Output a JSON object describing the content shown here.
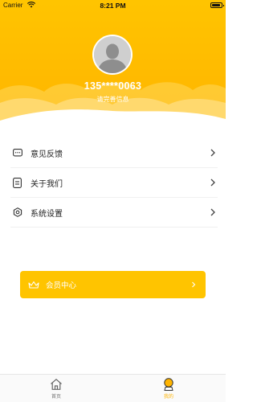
{
  "status_bar": {
    "carrier": "Carrier",
    "time": "8:21 PM"
  },
  "profile": {
    "phone": "135****0063",
    "subtitle": "请完善信息"
  },
  "menu": {
    "items": [
      {
        "label": "意见反馈",
        "icon": "feedback-icon"
      },
      {
        "label": "关于我们",
        "icon": "document-icon"
      },
      {
        "label": "系统设置",
        "icon": "settings-gear-icon"
      }
    ]
  },
  "member": {
    "label": "会员中心",
    "icon": "crown-icon"
  },
  "tabbar": {
    "tabs": [
      {
        "label": "首页",
        "icon": "home-icon",
        "active": false
      },
      {
        "label": "我的",
        "icon": "profile-icon",
        "active": true
      }
    ]
  },
  "colors": {
    "accent": "#FFC400",
    "header_bottom": "#FFB400",
    "active_tab": "#FFB400"
  }
}
